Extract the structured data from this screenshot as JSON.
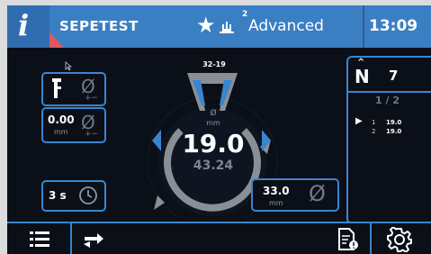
{
  "header": {
    "info_icon": "i",
    "user": "SEPETEST",
    "level_icon": "hands-icon",
    "level_sup": "2",
    "level": "Advanced",
    "time": "13:09"
  },
  "left": {
    "diameter_value": "0.00",
    "diameter_unit": "mm",
    "time_value": "3 s"
  },
  "dial": {
    "range": "32-19",
    "symbol": "Ø",
    "unit": "mm",
    "value": "19.0",
    "sub_value": "43.24"
  },
  "value_box": {
    "value": "33.0",
    "unit": "mm"
  },
  "right_panel": {
    "n_label": "N",
    "n_value": "7",
    "page": "1 / 2",
    "rows": [
      {
        "index": "1",
        "value": "19.0"
      },
      {
        "index": "2",
        "value": "19.0"
      }
    ]
  },
  "colors": {
    "accent": "#3a85cf",
    "header": "#3b7fc3",
    "background": "#0b1018",
    "warning_triangle": "#e05a5a"
  }
}
